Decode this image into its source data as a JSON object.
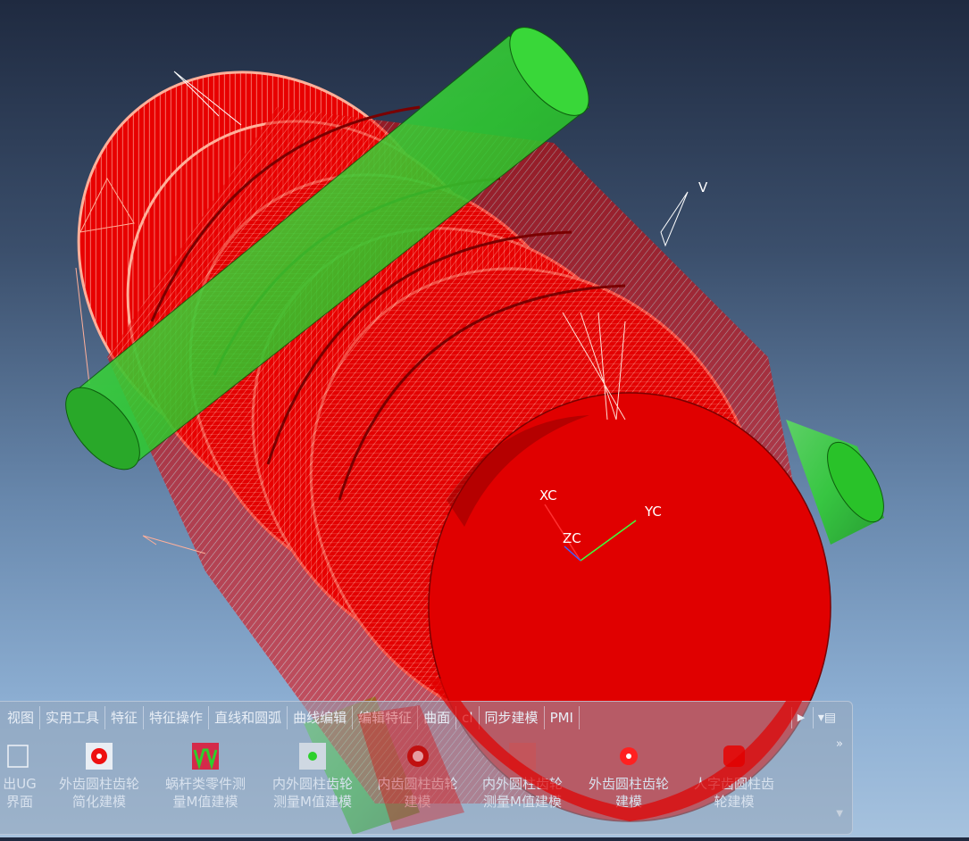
{
  "scene": {
    "axes": {
      "xc": "XC",
      "yc": "YC",
      "zc": "ZC"
    },
    "triad_mark": "V",
    "colors": {
      "gear": "#ea0000",
      "gear_dark": "#b00000",
      "shaft": "#2fd12f",
      "mesh_lines": "#ffb09a",
      "background_top": "#1f2a40",
      "background_bottom": "#a6c2de"
    }
  },
  "ribbon": {
    "tabs": [
      {
        "label": "视图"
      },
      {
        "label": "实用工具"
      },
      {
        "label": "特征"
      },
      {
        "label": "特征操作"
      },
      {
        "label": "直线和圆弧"
      },
      {
        "label": "曲线编辑"
      },
      {
        "label": "编辑特征"
      },
      {
        "label": "曲面"
      },
      {
        "label": "cl"
      },
      {
        "label": "同步建模"
      },
      {
        "label": "PMI"
      }
    ],
    "tab_more_icon": "triangle-right-icon",
    "ribbon_options_icon": "ribbon-options-icon",
    "overflow": "»",
    "buttons": [
      {
        "line1": "出UG",
        "line2": "界面",
        "icon": "exit-icon"
      },
      {
        "line1": "外齿圆柱齿轮",
        "line2": "简化建模",
        "icon": "gear-icon"
      },
      {
        "line1": "蜗杆类零件测",
        "line2": "量M值建模",
        "icon": "worm-measure-icon"
      },
      {
        "line1": "内外圆柱齿轮",
        "line2": "测量M值建模",
        "icon": "gear-measure-icon"
      },
      {
        "line1": "内齿圆柱齿轮",
        "line2": "建模",
        "icon": "internal-gear-icon"
      },
      {
        "line1": "内外圆柱齿轮",
        "line2": "测量M值建模",
        "icon": "gear-measure-icon"
      },
      {
        "line1": "外齿圆柱齿轮",
        "line2": "建模",
        "icon": "gear-icon"
      },
      {
        "line1": "人字齿圆柱齿",
        "line2": "轮建模",
        "icon": "herringbone-gear-icon"
      }
    ]
  }
}
